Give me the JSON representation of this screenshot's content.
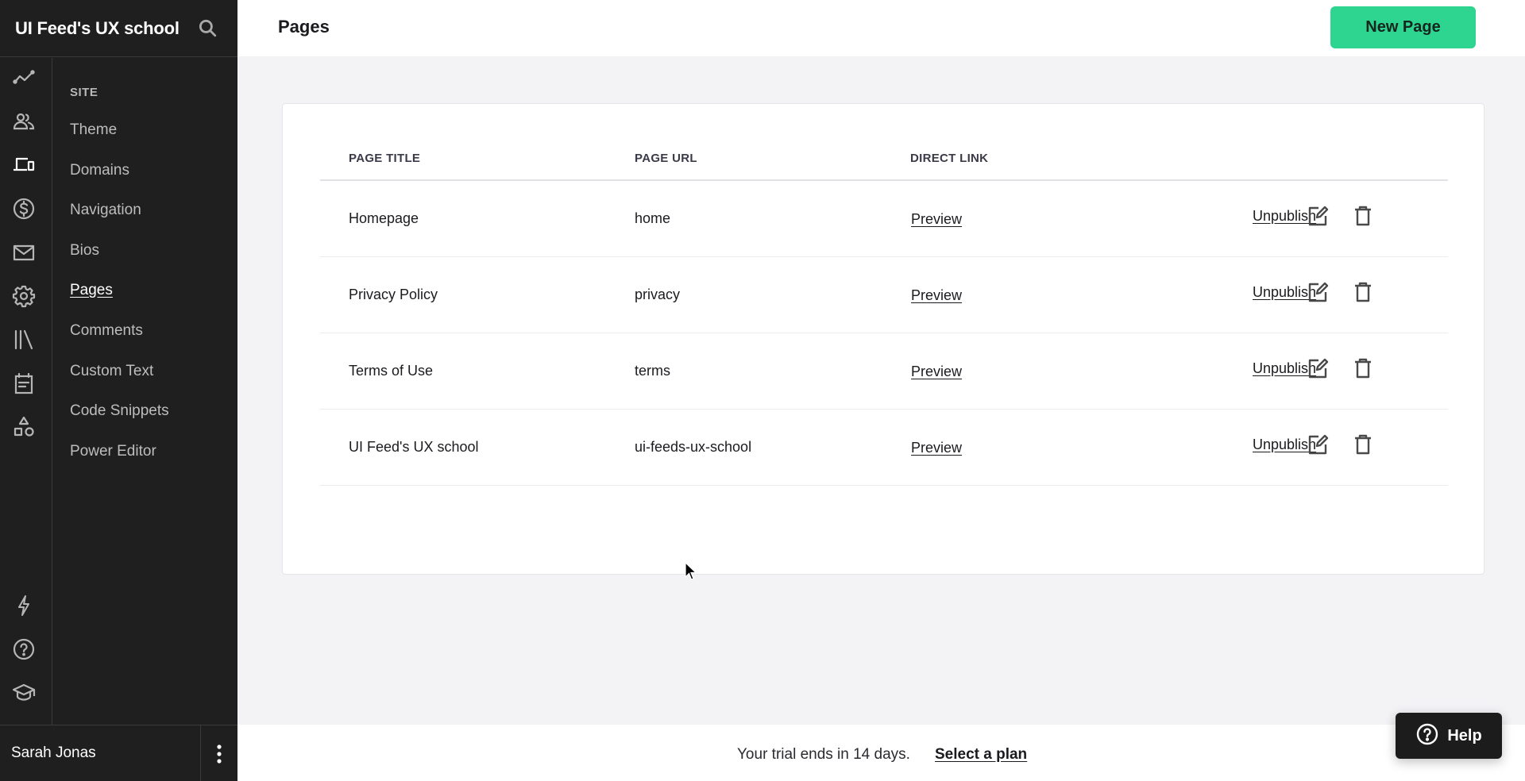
{
  "sidebar": {
    "brand": "UI Feed's UX school",
    "rail_icons": [
      "analytics-icon",
      "people-icon",
      "devices-icon",
      "dollar-icon",
      "mail-icon",
      "gear-icon",
      "library-icon",
      "calendar-icon",
      "shapes-icon",
      "lightning-icon",
      "help-circle-icon",
      "graduation-cap-icon"
    ],
    "section_heading": "SITE",
    "items": [
      {
        "label": "Theme"
      },
      {
        "label": "Domains"
      },
      {
        "label": "Navigation"
      },
      {
        "label": "Bios"
      },
      {
        "label": "Pages",
        "active": true
      },
      {
        "label": "Comments"
      },
      {
        "label": "Custom Text"
      },
      {
        "label": "Code Snippets"
      },
      {
        "label": "Power Editor"
      }
    ],
    "user_name": "Sarah Jonas"
  },
  "header": {
    "title": "Pages",
    "new_page_label": "New Page",
    "accent_color": "#2ed591"
  },
  "table": {
    "columns": [
      "PAGE TITLE",
      "PAGE URL",
      "DIRECT LINK"
    ],
    "rows": [
      {
        "title": "Homepage",
        "url": "home",
        "link": "Preview",
        "action": "Unpublish"
      },
      {
        "title": "Privacy Policy",
        "url": "privacy",
        "link": "Preview",
        "action": "Unpublish"
      },
      {
        "title": "Terms of Use",
        "url": "terms",
        "link": "Preview",
        "action": "Unpublish"
      },
      {
        "title": "UI Feed's UX school",
        "url": "ui-feeds-ux-school",
        "link": "Preview",
        "action": "Unpublish"
      }
    ]
  },
  "footer": {
    "trial_text": "Your trial ends in 14 days.",
    "trial_link": "Select a plan",
    "help_label": "Help"
  }
}
